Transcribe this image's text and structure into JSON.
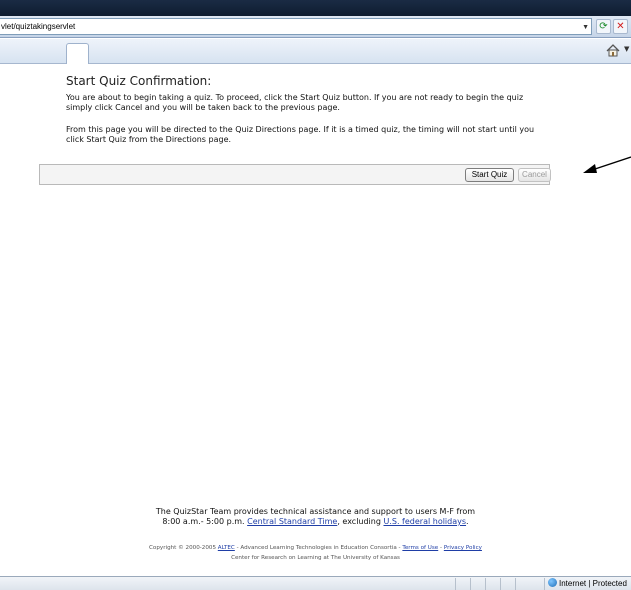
{
  "browser": {
    "address": "vlet/quiztakingservlet",
    "refresh_icon": "refresh-icon",
    "stop_icon": "stop-icon",
    "home_icon": "home-icon",
    "zone_text": "Internet | Protected"
  },
  "page": {
    "title": "Start Quiz Confirmation:",
    "para1": "You are about to begin taking a quiz. To proceed, click the Start Quiz button. If you are not ready to begin the quiz simply click Cancel and you will be taken back to the previous page.",
    "para2": "From this page you will be directed to the Quiz Directions page. If it is a timed quiz, the timing will not start until you click Start Quiz from the Directions page.",
    "start_button": "Start Quiz",
    "cancel_button": "Cancel"
  },
  "footer": {
    "support_line1": "The QuizStar Team provides technical assistance and support to users M-F from",
    "support_hours": "8:00 a.m.- 5:00 p.m.",
    "central_time_link": "Central Standard Time",
    "excluding_text": ", excluding",
    "holidays_link": "U.S. federal holidays",
    "period": ".",
    "copyright_text": "Copyright © 2000-2005",
    "altec_link": "ALTEC",
    "altec_desc": "- Advanced Learning Technologies in Education Consortia -",
    "terms_link": "Terms of Use",
    "dash": "-",
    "privacy_link": "Privacy Policy",
    "center_line": "Center for Research on Learning at The University of Kansas"
  },
  "colors": {
    "link": "#1f3ea6",
    "arrow": "#000000"
  }
}
